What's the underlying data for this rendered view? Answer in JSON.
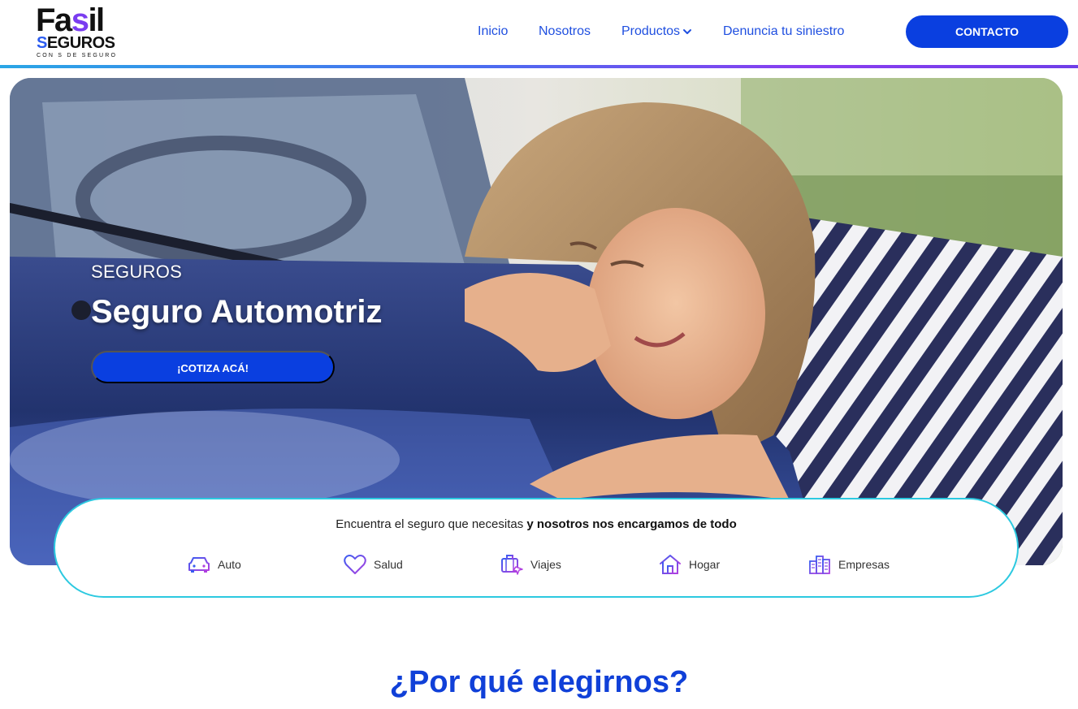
{
  "brand": {
    "name_part1": "Fa",
    "name_s": "s",
    "name_part2": "il",
    "sub_s": "S",
    "sub_rest": "EGUROS",
    "tagline": "CON S DE SEGURO",
    "colors": {
      "primary": "#0a3fe0",
      "purple": "#7a3df0",
      "cyan": "#2cc9e0"
    }
  },
  "nav": {
    "items": [
      {
        "label": "Inicio"
      },
      {
        "label": "Nosotros"
      },
      {
        "label": "Productos",
        "icon": "chevron-down-icon"
      },
      {
        "label": "Denuncia tu siniestro"
      }
    ],
    "contact_label": "CONTACTO"
  },
  "hero": {
    "kicker": "SEGUROS",
    "title": "Seguro Automotriz",
    "cta_label": "¡COTIZA ACÁ!"
  },
  "finder": {
    "text_regular": "Encuentra el seguro que necesitas ",
    "text_bold": "y nosotros nos encargamos de todo",
    "categories": [
      {
        "label": "Auto",
        "icon": "car-icon"
      },
      {
        "label": "Salud",
        "icon": "heart-icon"
      },
      {
        "label": "Viajes",
        "icon": "luggage-icon"
      },
      {
        "label": "Hogar",
        "icon": "house-icon"
      },
      {
        "label": "Empresas",
        "icon": "buildings-icon"
      }
    ]
  },
  "section": {
    "title": "¿Por qué elegirnos?"
  }
}
